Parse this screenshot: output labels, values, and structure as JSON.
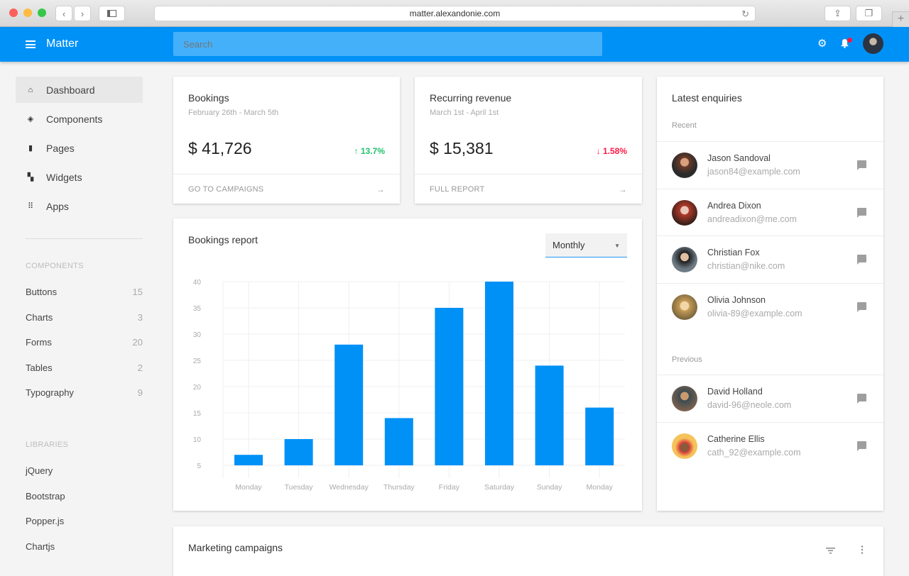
{
  "browser": {
    "url": "matter.alexandonie.com"
  },
  "header": {
    "brand": "Matter",
    "search_placeholder": "Search"
  },
  "sidebar": {
    "main": [
      {
        "label": "Dashboard",
        "icon": "home-icon",
        "active": true
      },
      {
        "label": "Components",
        "icon": "layers-icon"
      },
      {
        "label": "Pages",
        "icon": "page-icon"
      },
      {
        "label": "Widgets",
        "icon": "widgets-icon"
      },
      {
        "label": "Apps",
        "icon": "apps-grid-icon"
      }
    ],
    "components_title": "COMPONENTS",
    "components": [
      {
        "label": "Buttons",
        "count": "15"
      },
      {
        "label": "Charts",
        "count": "3"
      },
      {
        "label": "Forms",
        "count": "20"
      },
      {
        "label": "Tables",
        "count": "2"
      },
      {
        "label": "Typography",
        "count": "9"
      }
    ],
    "libraries_title": "LIBRARIES",
    "libraries": [
      "jQuery",
      "Bootstrap",
      "Popper.js",
      "Chartjs"
    ]
  },
  "stats": [
    {
      "title": "Bookings",
      "range": "February 26th - March 5th",
      "value": "$ 41,726",
      "change": "↑ 13.7%",
      "direction": "up",
      "link": "GO TO CAMPAIGNS"
    },
    {
      "title": "Recurring revenue",
      "range": "March 1st - April 1st",
      "value": "$ 15,381",
      "change": "↓ 1.58%",
      "direction": "down",
      "link": "FULL REPORT"
    }
  ],
  "report": {
    "title": "Bookings report",
    "period": "Monthly"
  },
  "chart_data": {
    "type": "bar",
    "title": "Bookings report",
    "categories": [
      "Monday",
      "Tuesday",
      "Wednesday",
      "Thursday",
      "Friday",
      "Saturday",
      "Sunday",
      "Monday"
    ],
    "values": [
      7,
      10,
      28,
      14,
      35,
      40,
      24,
      16
    ],
    "xlabel": "",
    "ylabel": "",
    "ylim": [
      5,
      40
    ],
    "yticks": [
      5,
      10,
      15,
      20,
      25,
      30,
      35,
      40
    ],
    "grid": true,
    "bar_color": "#0091f7"
  },
  "enquiries": {
    "title": "Latest enquiries",
    "recent_label": "Recent",
    "previous_label": "Previous",
    "recent": [
      {
        "name": "Jason Sandoval",
        "email": "jason84@example.com"
      },
      {
        "name": "Andrea Dixon",
        "email": "andreadixon@me.com"
      },
      {
        "name": "Christian Fox",
        "email": "christian@nike.com"
      },
      {
        "name": "Olivia Johnson",
        "email": "olivia-89@example.com"
      }
    ],
    "previous": [
      {
        "name": "David Holland",
        "email": "david-96@neole.com"
      },
      {
        "name": "Catherine Ellis",
        "email": "cath_92@example.com"
      }
    ]
  },
  "marketing": {
    "title": "Marketing campaigns"
  },
  "colors": {
    "primary": "#0091f7",
    "positive": "#1fc36b",
    "negative": "#ff1744"
  }
}
